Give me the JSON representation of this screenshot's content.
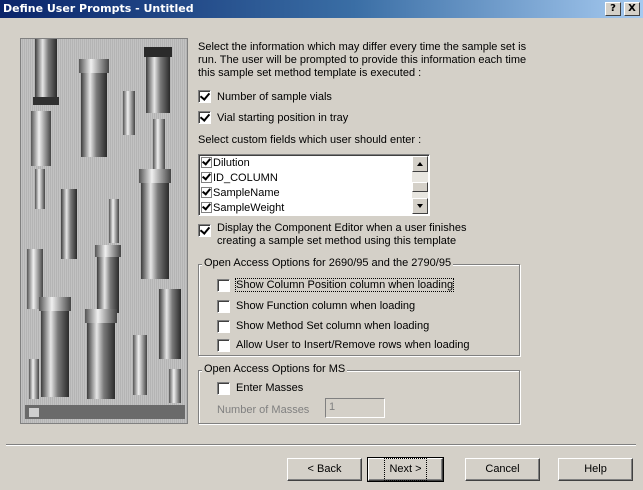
{
  "window": {
    "title": "Define User Prompts - Untitled",
    "help_glyph": "?",
    "close_glyph": "X"
  },
  "intro_text": [
    "Select the information which may differ every time the sample set is",
    "run.  The user will be prompted to provide this information each time",
    "this sample set method template is executed :"
  ],
  "options": {
    "num_vials": {
      "label": "Number of sample vials",
      "checked": true
    },
    "vial_position": {
      "label": "Vial starting position in tray",
      "checked": true
    }
  },
  "custom_fields": {
    "label": "Select custom fields which user should enter :",
    "items": [
      {
        "label": "Dilution",
        "checked": true
      },
      {
        "label": "ID_COLUMN",
        "checked": true
      },
      {
        "label": "SampleName",
        "checked": true
      },
      {
        "label": "SampleWeight",
        "checked": true
      }
    ]
  },
  "component_editor": {
    "label_line1": "Display the Component Editor when a user finishes",
    "label_line2": "creating a sample set method using this template",
    "checked": true
  },
  "open_access_2690": {
    "title": "Open Access Options for 2690/95 and the 2790/95",
    "items": [
      {
        "label": "Show Column Position column when loading",
        "checked": false
      },
      {
        "label": "Show Function column when loading",
        "checked": false
      },
      {
        "label": "Show Method Set column when loading",
        "checked": false
      },
      {
        "label": "Allow User to Insert/Remove rows when loading",
        "checked": false
      }
    ]
  },
  "open_access_ms": {
    "title": "Open Access Options for MS",
    "enter_masses": {
      "label": "Enter Masses",
      "checked": false
    },
    "num_masses_label": "Number of Masses",
    "num_masses_value": "1"
  },
  "buttons": {
    "back": "< Back",
    "next": "Next >",
    "cancel": "Cancel",
    "help": "Help"
  },
  "icons": {
    "help": "help-icon",
    "close": "close-icon",
    "wizard_art": "sample-vials-image"
  }
}
